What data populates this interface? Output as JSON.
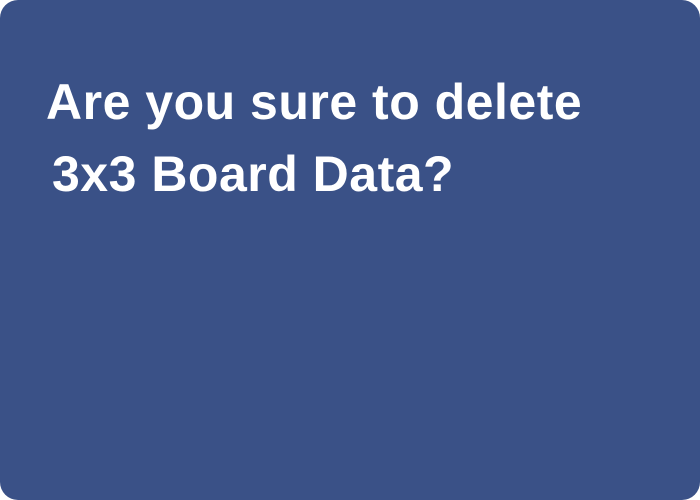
{
  "dialog": {
    "message_line1": "Are you sure to delete",
    "message_line2": "3x3 Board Data?"
  },
  "colors": {
    "dialog_background": "#3a5187",
    "message_text": "#ffffff"
  }
}
